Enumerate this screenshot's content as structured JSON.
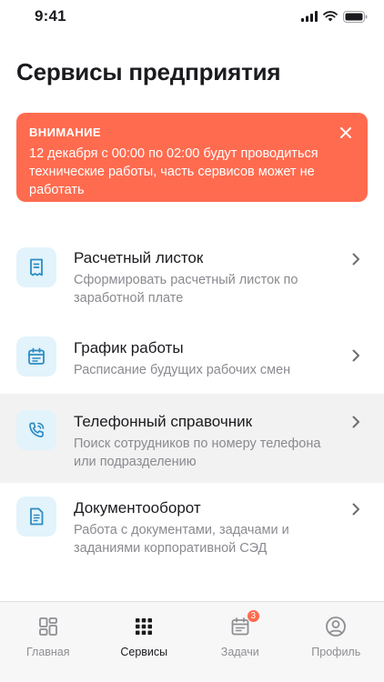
{
  "status_bar": {
    "time": "9:41"
  },
  "page": {
    "title": "Сервисы предприятия"
  },
  "alert": {
    "title": "ВНИМАНИЕ",
    "text": "12 декабря с 00:00 по 02:00 будут проводиться технические работы, часть сервисов может не работать",
    "color": "#ff6b4f"
  },
  "services": [
    {
      "title": "Расчетный листок",
      "description": "Сформировать расчетный листок по заработной плате",
      "icon": "receipt-icon"
    },
    {
      "title": "График работы",
      "description": "Расписание будущих рабочих смен",
      "icon": "calendar-icon"
    },
    {
      "title": "Телефонный справочник",
      "description": "Поиск сотрудников по номеру телефона или подразделению",
      "icon": "phone-icon"
    },
    {
      "title": "Документооборот",
      "description": "Работа с документами, задачами и заданиями корпоративной СЭД",
      "icon": "document-icon"
    }
  ],
  "tab_bar": {
    "tabs": [
      {
        "label": "Главная",
        "icon": "home-grid-icon"
      },
      {
        "label": "Сервисы",
        "icon": "services-grid-icon",
        "active": true
      },
      {
        "label": "Задачи",
        "icon": "tasks-calendar-icon",
        "badge": "3"
      },
      {
        "label": "Профиль",
        "icon": "profile-icon"
      }
    ]
  },
  "colors": {
    "accent": "#ff6b4f",
    "icon_bg": "#e2f3fb",
    "icon_stroke": "#2c8cc4"
  }
}
